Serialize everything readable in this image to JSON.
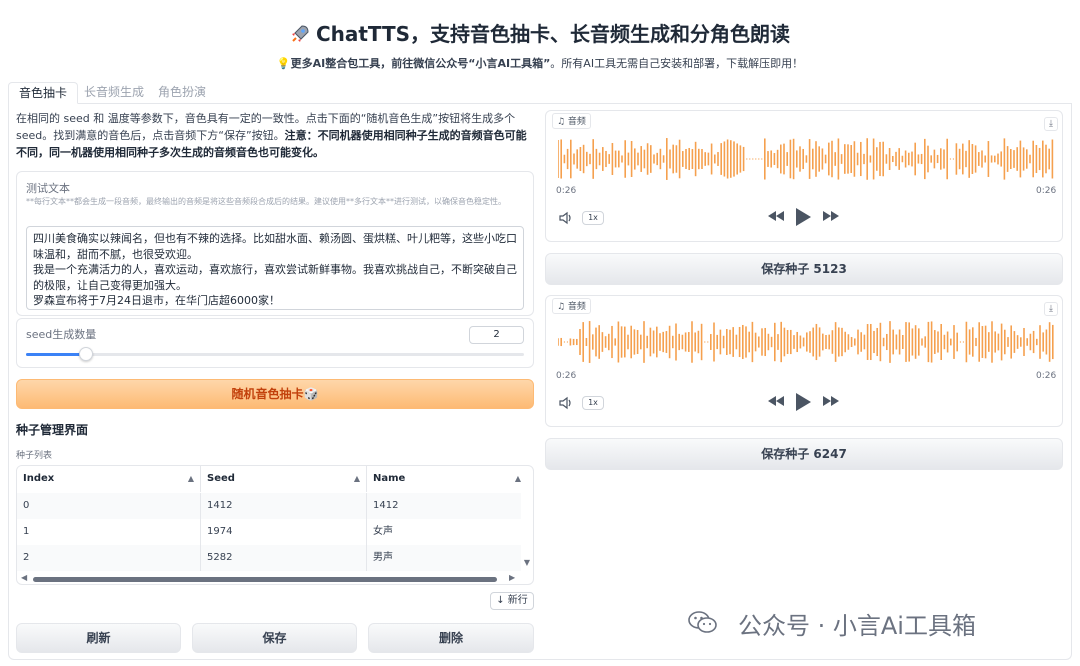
{
  "header": {
    "title": "ChatTTS，支持音色抽卡、长音频生成和分角色朗读",
    "subtitle_bold": "更多AI整合包工具，前往微信公众号“小言AI工具箱”",
    "subtitle_rest": "。所有AI工具无需自己安装和部署，下载解压即用！"
  },
  "tabs": [
    {
      "label": "音色抽卡"
    },
    {
      "label": "长音频生成"
    },
    {
      "label": "角色扮演"
    }
  ],
  "description": {
    "normal": "在相同的 seed 和 温度等参数下，音色具有一定的一致性。点击下面的“随机音色生成”按钮将生成多个 seed。找到满意的音色后，点击音频下方“保存”按钮。",
    "bold": "注意：不同机器使用相同种子生成的音频音色可能不同，同一机器使用相同种子多次生成的音频音色也可能变化。"
  },
  "test_text": {
    "label": "测试文本",
    "hint": "**每行文本**都会生成一段音频，最终输出的音频是将这些音频段合成后的结果。建议使用**多行文本**进行测试，以确保音色稳定性。",
    "value": "四川美食确实以辣闻名，但也有不辣的选择。比如甜水面、赖汤圆、蛋烘糕、叶儿粑等，这些小吃口味温和，甜而不腻，也很受欢迎。\n我是一个充满活力的人，喜欢运动，喜欢旅行，喜欢尝试新鲜事物。我喜欢挑战自己，不断突破自己的极限，让自己变得更加强大。\n罗森宣布将于7月24日退市，在华门店超6000家！"
  },
  "seed_count": {
    "label": "seed生成数量",
    "value": "2",
    "fraction": 0.12
  },
  "random_button": {
    "label": "随机音色抽卡🎲"
  },
  "seed_manager": {
    "title": "种子管理界面",
    "table_label": "种子列表",
    "columns": [
      "Index",
      "Seed",
      "Name"
    ],
    "rows": [
      [
        "0",
        "1412",
        "1412"
      ],
      [
        "1",
        "1974",
        "女声"
      ],
      [
        "2",
        "5282",
        "男声"
      ]
    ],
    "new_row_label": "↓ 新行"
  },
  "actions": {
    "refresh": "刷新",
    "save": "保存",
    "delete": "删除"
  },
  "audio1": {
    "tag": "♫ 音频",
    "time_start": "0:26",
    "time_end": "0:26",
    "speed": "1x",
    "save_label": "保存种子",
    "seed": "5123"
  },
  "audio2": {
    "tag": "♫ 音频",
    "time_start": "0:26",
    "time_end": "0:26",
    "speed": "1x",
    "save_label": "保存种子",
    "seed": "6247"
  },
  "watermark": {
    "text": "公众号 · 小言Ai工具箱"
  },
  "colors": {
    "accent": "#f97316",
    "wave": "#f5a04e"
  }
}
